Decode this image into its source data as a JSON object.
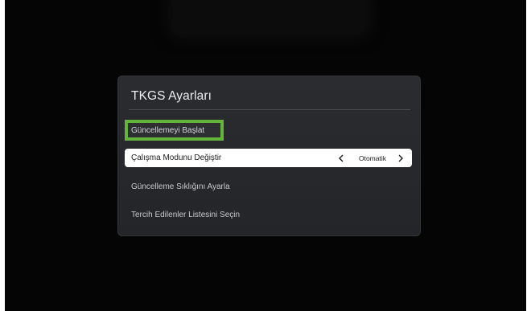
{
  "dialog": {
    "title": "TKGS Ayarları",
    "items": [
      {
        "label": "Güncellemeyi Başlat",
        "state": "focused"
      },
      {
        "label": "Çalışma Modunu Değiştir",
        "value": "Otomatik",
        "state": "selected"
      },
      {
        "label": "Güncelleme Sıklığını Ayarla"
      },
      {
        "label": "Tercih Edilenler Listesini Seçin"
      }
    ]
  },
  "icons": {
    "prev": "chevron-left-icon",
    "next": "chevron-right-icon"
  },
  "colors": {
    "focus_border": "#63b43a",
    "dialog_bg": "#26282b",
    "screen_bg": "#050505",
    "selected_row": "#ffffff"
  }
}
